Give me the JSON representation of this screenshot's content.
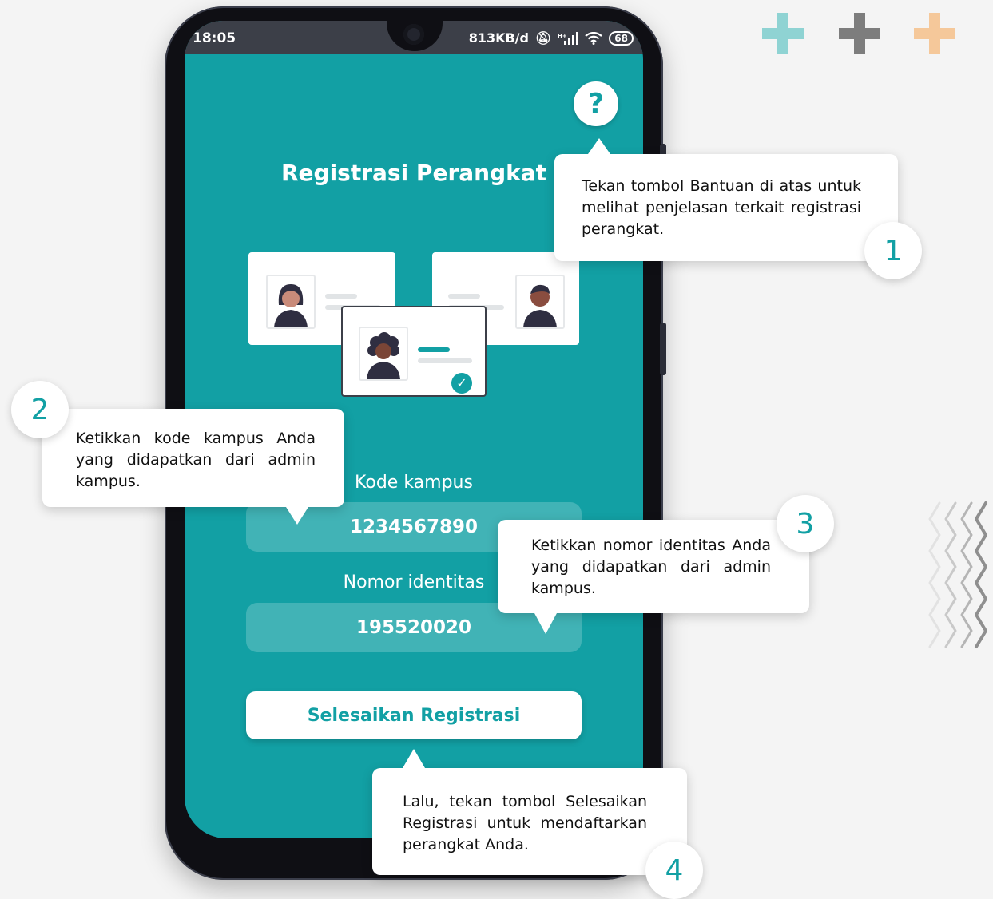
{
  "status_bar": {
    "time": "18:05",
    "speed": "813KB/d",
    "battery": "68"
  },
  "screen": {
    "help_label": "?",
    "title": "Registrasi Perangkat",
    "campus_code": {
      "label": "Kode kampus",
      "value": "1234567890"
    },
    "identity_number": {
      "label": "Nomor identitas",
      "value": "195520020"
    },
    "submit_label": "Selesaikan Registrasi"
  },
  "callouts": [
    {
      "number": "1",
      "text": "Tekan tombol Bantuan di atas untuk melihat penjelasan terkait registrasi perangkat."
    },
    {
      "number": "2",
      "text": "Ketikkan kode kampus Anda yang didapatkan dari admin kampus."
    },
    {
      "number": "3",
      "text": "Ketikkan nomor identitas Anda yang didapatkan dari admin kampus."
    },
    {
      "number": "4",
      "text": "Lalu, tekan tombol Selesaikan Registrasi untuk mendaftarkan perangkat Anda."
    }
  ],
  "colors": {
    "accent": "#12a0a4",
    "plus_teal": "#8fd3d3",
    "plus_gray": "#7d7d7d",
    "plus_peach": "#f5c89a"
  },
  "icons": [
    "help-icon",
    "check-icon",
    "bell-mute-icon",
    "signal-icon",
    "wifi-icon",
    "battery-icon",
    "plus-icon",
    "zigzag-icon"
  ]
}
